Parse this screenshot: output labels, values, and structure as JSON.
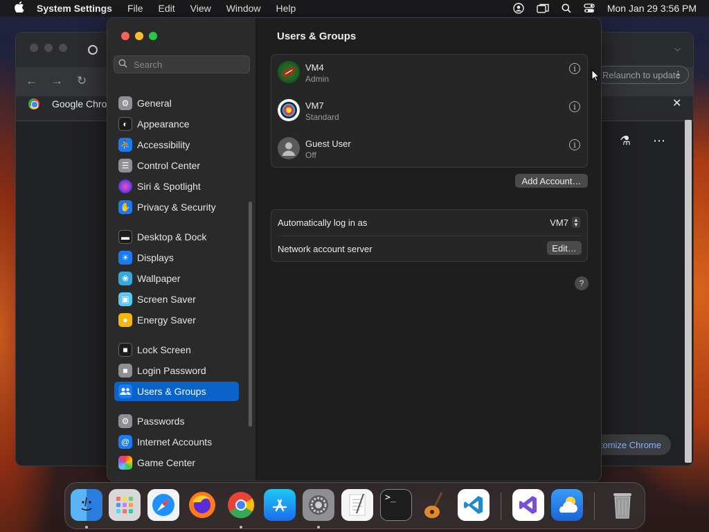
{
  "menubar": {
    "app_name": "System Settings",
    "menus": [
      "File",
      "Edit",
      "View",
      "Window",
      "Help"
    ],
    "datetime": "Mon Jan 29  3:56 PM"
  },
  "chrome": {
    "tab_title": "Google Chrome",
    "relaunch_label": "Relaunch to update",
    "customize_label": "Customize Chrome"
  },
  "sidebar": {
    "search_placeholder": "Search",
    "items": [
      {
        "label": "General",
        "icon": "gear-icon",
        "color": "#8e8e93"
      },
      {
        "label": "Appearance",
        "icon": "appearance-icon",
        "color": "#1c1c1e"
      },
      {
        "label": "Accessibility",
        "icon": "accessibility-icon",
        "color": "#1a7cf5"
      },
      {
        "label": "Control Center",
        "icon": "control-center-icon",
        "color": "#8e8e93"
      },
      {
        "label": "Siri & Spotlight",
        "icon": "siri-icon",
        "color": "#b23cd9"
      },
      {
        "label": "Privacy & Security",
        "icon": "hand-icon",
        "color": "#1a7cf5"
      },
      {
        "label": "Desktop & Dock",
        "icon": "dock-icon",
        "color": "#1c1c1e"
      },
      {
        "label": "Displays",
        "icon": "sun-icon",
        "color": "#1a7cf5"
      },
      {
        "label": "Wallpaper",
        "icon": "wallpaper-icon",
        "color": "#34aadc"
      },
      {
        "label": "Screen Saver",
        "icon": "screen-saver-icon",
        "color": "#5ac8fa"
      },
      {
        "label": "Energy Saver",
        "icon": "bulb-icon",
        "color": "#f5b70a"
      },
      {
        "label": "Lock Screen",
        "icon": "lock-icon",
        "color": "#1c1c1e"
      },
      {
        "label": "Login Password",
        "icon": "lock-icon",
        "color": "#8e8e93"
      },
      {
        "label": "Users & Groups",
        "icon": "users-icon",
        "color": "#1a7cf5"
      },
      {
        "label": "Passwords",
        "icon": "key-icon",
        "color": "#8e8e93"
      },
      {
        "label": "Internet Accounts",
        "icon": "at-icon",
        "color": "#1a7cf5"
      },
      {
        "label": "Game Center",
        "icon": "game-center-icon",
        "color": "#e0e0e0"
      }
    ],
    "selected": "Users & Groups"
  },
  "main": {
    "title": "Users & Groups",
    "users": [
      {
        "name": "VM4",
        "role": "Admin"
      },
      {
        "name": "VM7",
        "role": "Standard"
      },
      {
        "name": "Guest User",
        "role": "Off"
      }
    ],
    "add_account_label": "Add Account…",
    "auto_login_label": "Automatically log in as",
    "auto_login_value": "VM7",
    "network_server_label": "Network account server",
    "edit_label": "Edit…",
    "help_label": "?"
  },
  "dock": {
    "apps": [
      {
        "name": "finder",
        "color": "#2f8ff0"
      },
      {
        "name": "launchpad",
        "color": "#d8d8d8"
      },
      {
        "name": "safari",
        "color": "#f0f4f8"
      },
      {
        "name": "firefox",
        "color": "#ff7a1a"
      },
      {
        "name": "chrome",
        "color": "#ffffff"
      },
      {
        "name": "app-store",
        "color": "#1c8cf5"
      },
      {
        "name": "system-settings",
        "color": "#8e8e93"
      },
      {
        "name": "textedit",
        "color": "#f5f5f5"
      },
      {
        "name": "terminal",
        "color": "#1e1e1e"
      },
      {
        "name": "garageband",
        "color": "#3a2a20"
      },
      {
        "name": "vscode",
        "color": "#ffffff"
      },
      {
        "name": "visual-studio",
        "color": "#ffffff"
      },
      {
        "name": "weather",
        "color": "#2f8ff0"
      },
      {
        "name": "trash",
        "color": "#9a9a9a"
      }
    ]
  }
}
